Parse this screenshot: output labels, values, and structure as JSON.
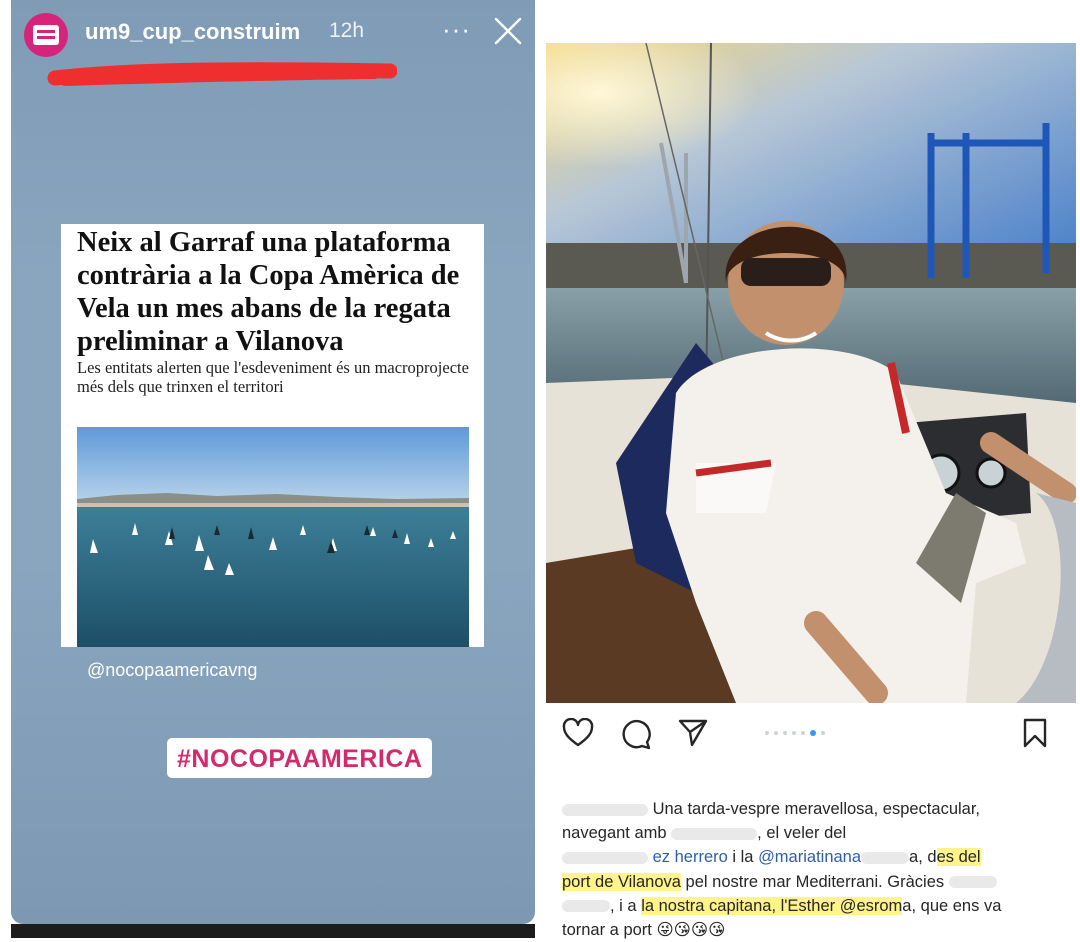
{
  "story": {
    "username": "um9_cup_construim",
    "time": "12h",
    "more_label": "···",
    "article": {
      "headline": "Neix al Garraf una plataforma contrària a la Copa Amèrica de Vela un mes abans de la regata preliminar a Vilanova",
      "subhead": "Les entitats alerten que l'esdeveniment és un macroprojecte més dels que trinxen el territori"
    },
    "mention": "@nocopaamericavng",
    "hashtag": "#NOCOPAAMERICA"
  },
  "post": {
    "carousel": {
      "total": 7,
      "active": 5
    },
    "caption": {
      "l1": "Una tarda-vespre meravellosa, espectacular,",
      "l2a": "navegant amb",
      "l2b": ", el veler del",
      "l3a": "ez herrero",
      "l3b": " i la ",
      "l3c": "@mariatinana",
      "l3d": "a, d",
      "l3e": "es del",
      "l4a": "port de Vilanova",
      "l4b": " pel nostre mar Mediterrani. Gràcies",
      "l5a": ", i a ",
      "l5b": "la nostra capitana, l'Esther @esrom",
      "l5c": "a, que ens va",
      "l6a": "tornar a port",
      "l6b": "😜😘😘😘"
    }
  },
  "colors": {
    "brand": "#d8237d",
    "hashtag": "#d32a6b",
    "highlight": "#fff48a",
    "link": "#2f5ea8",
    "active_dot": "#3897f0"
  }
}
